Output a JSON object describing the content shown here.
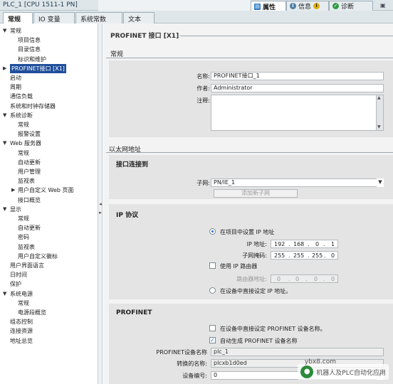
{
  "window": {
    "title": "PLC_1 [CPU 1511-1 PN]"
  },
  "inspector_tabs": [
    {
      "label": "属性",
      "icon": "properties-icon"
    },
    {
      "label": "信息",
      "icon": "info-icon"
    },
    {
      "label": "诊断",
      "icon": "diagnostics-icon"
    }
  ],
  "subtabs": [
    "常规",
    "IO 变量",
    "系统常数",
    "文本"
  ],
  "tree": [
    {
      "label": "常规",
      "level": 0,
      "expanded": true
    },
    {
      "label": "项目信息",
      "level": 1
    },
    {
      "label": "目录信息",
      "level": 1
    },
    {
      "label": "标识和维护",
      "level": 1
    },
    {
      "label": "PROFINET接口 [X1]",
      "level": 0,
      "collapsed": true,
      "selected": true
    },
    {
      "label": "启动",
      "level": 0
    },
    {
      "label": "周期",
      "level": 0
    },
    {
      "label": "通信负载",
      "level": 0
    },
    {
      "label": "系统和时钟存储器",
      "level": 0
    },
    {
      "label": "系统诊断",
      "level": 0,
      "expanded": true
    },
    {
      "label": "常规",
      "level": 1
    },
    {
      "label": "报警设置",
      "level": 1
    },
    {
      "label": "Web 服务器",
      "level": 0,
      "expanded": true
    },
    {
      "label": "常规",
      "level": 1
    },
    {
      "label": "自动更新",
      "level": 1
    },
    {
      "label": "用户管理",
      "level": 1
    },
    {
      "label": "监视表",
      "level": 1
    },
    {
      "label": "用户自定义 Web 页面",
      "level": 1,
      "collapsed": true
    },
    {
      "label": "接口概览",
      "level": 1
    },
    {
      "label": "显示",
      "level": 0,
      "expanded": true
    },
    {
      "label": "常规",
      "level": 1
    },
    {
      "label": "自动更新",
      "level": 1
    },
    {
      "label": "密码",
      "level": 1
    },
    {
      "label": "监视表",
      "level": 1
    },
    {
      "label": "用户自定义徽标",
      "level": 1
    },
    {
      "label": "用户界面语言",
      "level": 0
    },
    {
      "label": "日时间",
      "level": 0
    },
    {
      "label": "保护",
      "level": 0
    },
    {
      "label": "系统电源",
      "level": 0,
      "expanded": true
    },
    {
      "label": "常规",
      "level": 1
    },
    {
      "label": "电源段概览",
      "level": 1
    },
    {
      "label": "组态控制",
      "level": 0
    },
    {
      "label": "连接资源",
      "level": 0
    },
    {
      "label": "地址总览",
      "level": 0
    }
  ],
  "content": {
    "header": "PROFINET 接口 [X1]",
    "general": {
      "title": "常规",
      "name_label": "名称:",
      "name_value": "PROFINET接口_1",
      "author_label": "作者:",
      "author_value": "Administrator",
      "comment_label": "注释:",
      "comment_value": ""
    },
    "ethernet": {
      "title": "以太网地址",
      "interface_title": "接口连接到",
      "subnet_label": "子网:",
      "subnet_value": "PN/IE_1",
      "add_subnet_button": "添加新子网",
      "ip_title": "IP 协议",
      "radio_project": "在项目中设置 IP 地址",
      "ip_label": "IP 地址:",
      "ip_value": [
        "192",
        "168",
        "0",
        "1"
      ],
      "mask_label": "子网掩码:",
      "mask_value": [
        "255",
        "255",
        "255",
        "0"
      ],
      "use_router_label": "使用 IP 路由器",
      "router_label": "路由器地址:",
      "router_value": [
        "0",
        "0",
        "0",
        "0"
      ],
      "radio_direct": "在设备中直接设定 IP 地址。"
    },
    "profinet": {
      "title": "PROFINET",
      "direct_name_label": "在设备中直接设定 PROFINET 设备名称。",
      "auto_name_label": "自动生成 PROFINET 设备名称",
      "device_name_label": "PROFINET设备名称",
      "device_name_value": "plc_1",
      "converted_label": "转换的名称:",
      "converted_value": "plcxb1d0ed",
      "device_no_label": "设备编号:",
      "device_no_value": "0"
    }
  },
  "watermark": {
    "text": "机器人及PLC自动化应用",
    "domain": "ybx8.com"
  },
  "colors": {
    "selected": "#1f4e9b",
    "accent": "#1f6fd1",
    "panel": "#e4e4e4"
  }
}
